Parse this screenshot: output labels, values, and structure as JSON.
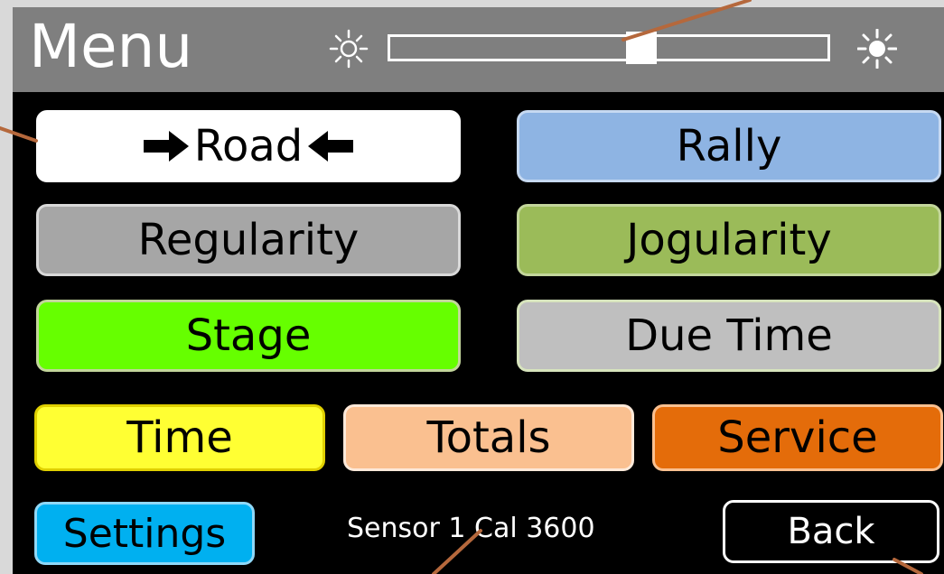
{
  "header": {
    "title": "Menu",
    "brightness": {
      "level": 0.58,
      "min_icon": "sun-dim-icon",
      "max_icon": "sun-bright-icon"
    }
  },
  "buttons": {
    "road": {
      "label": "Road",
      "selected": true,
      "color": "#ffffff"
    },
    "rally": {
      "label": "Rally",
      "color": "#8eb4e3"
    },
    "regularity": {
      "label": "Regularity",
      "color": "#a6a6a6"
    },
    "jogularity": {
      "label": "Jogularity",
      "color": "#9bbb59"
    },
    "stage": {
      "label": "Stage",
      "color": "#66ff00"
    },
    "due_time": {
      "label": "Due Time",
      "color": "#bfbfbf"
    },
    "time": {
      "label": "Time",
      "color": "#ffff33"
    },
    "totals": {
      "label": "Totals",
      "color": "#fac090"
    },
    "service": {
      "label": "Service",
      "color": "#e46c0a"
    },
    "settings": {
      "label": "Settings",
      "color": "#00b0f0"
    },
    "back": {
      "label": "Back"
    }
  },
  "status": {
    "sensor_text": "Sensor 1 Cal 3600"
  },
  "colors": {
    "screen_bg": "#000000",
    "header_bg": "#7f7f7f",
    "callout": "#b5683c"
  }
}
